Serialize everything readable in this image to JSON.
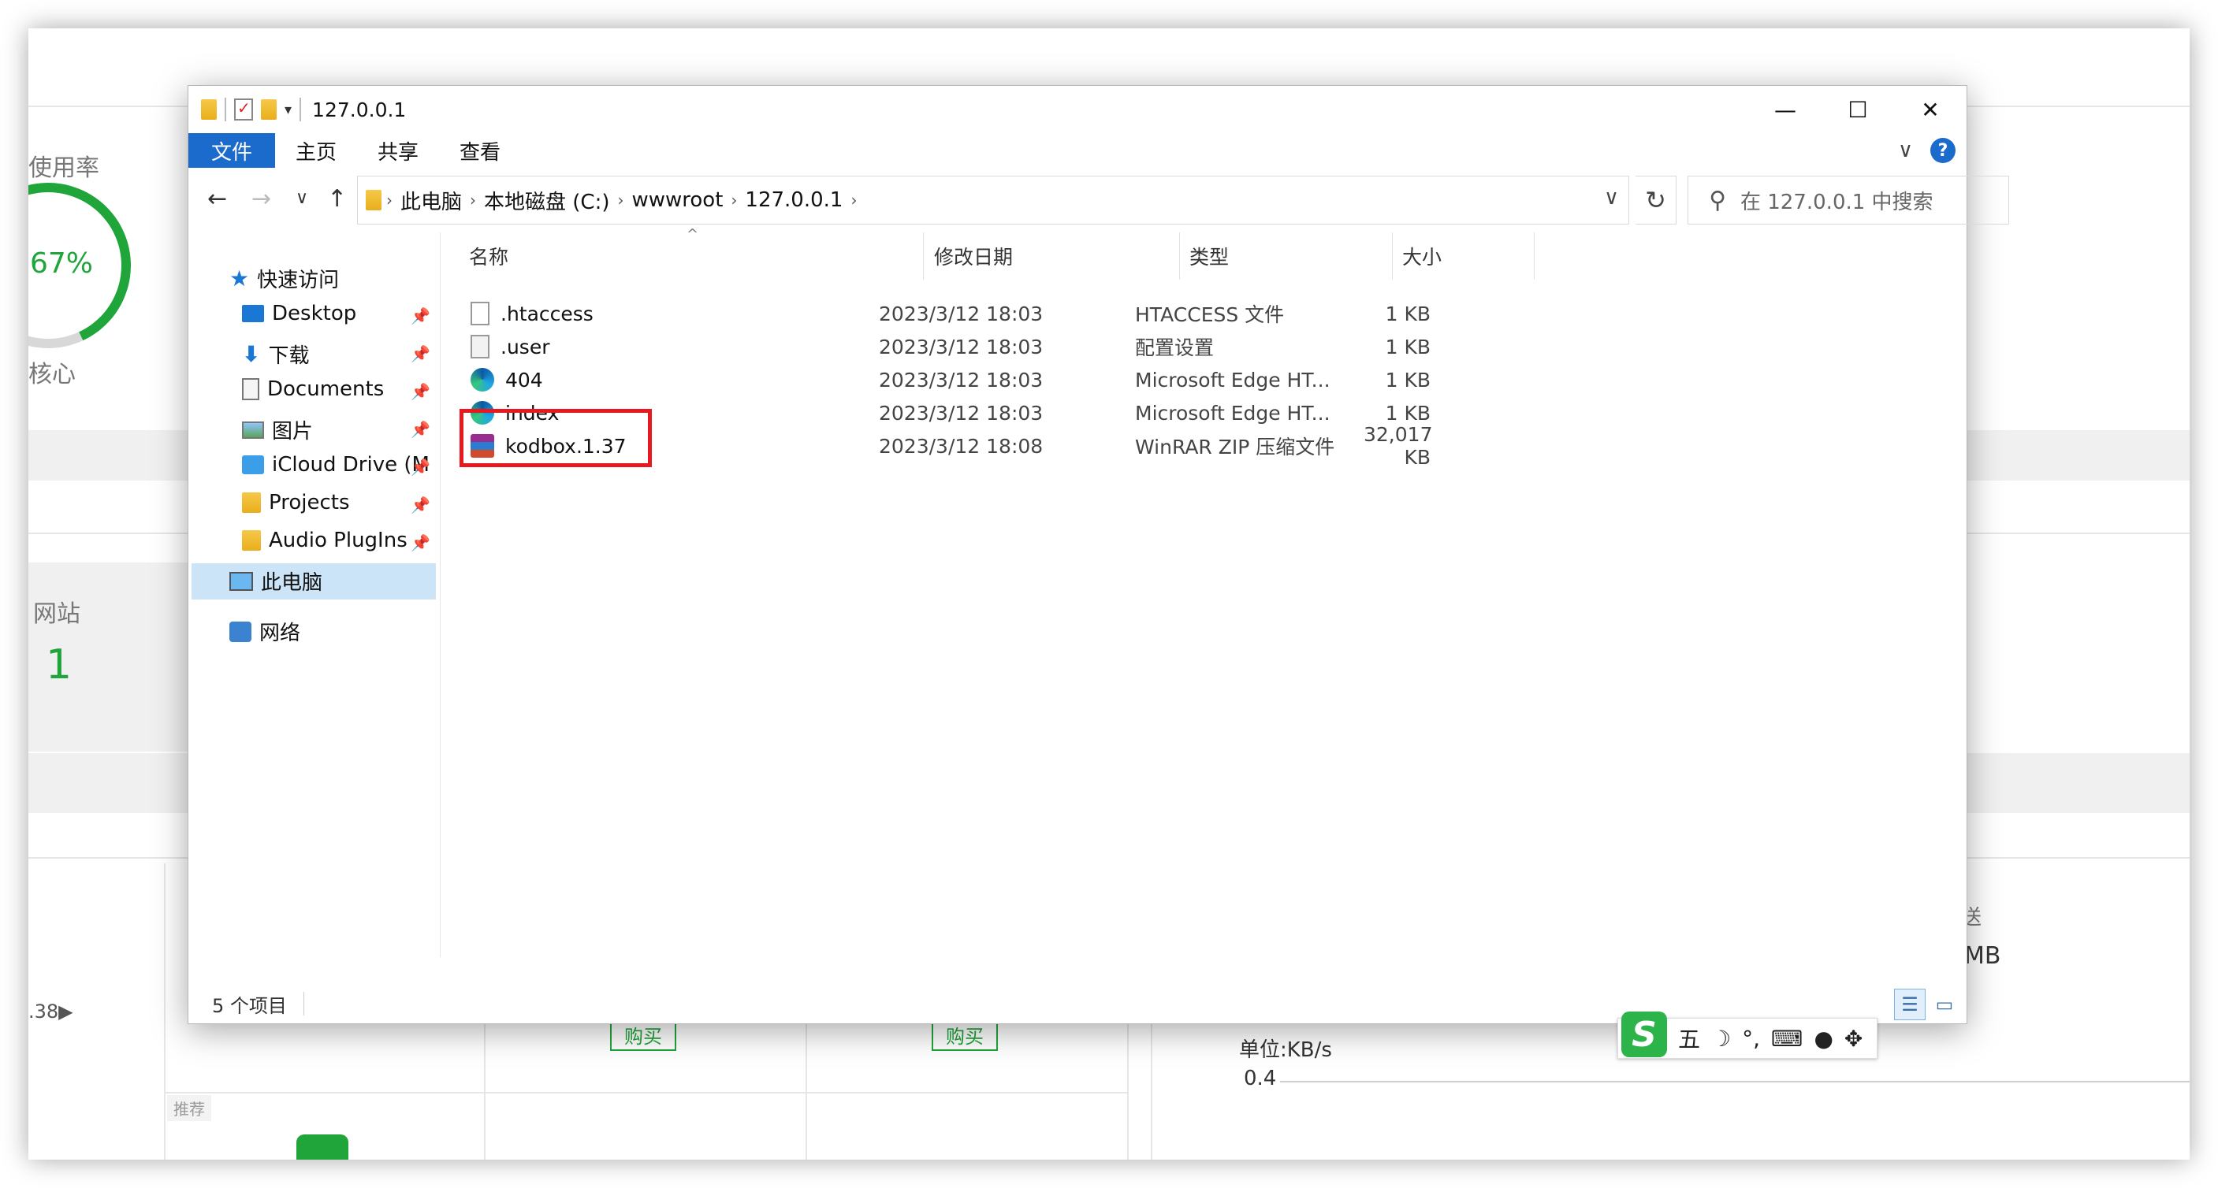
{
  "background": {
    "usage_label": "使用率",
    "usage_percent": "67%",
    "core_label": "核心",
    "site_label": "网站",
    "site_count": "1",
    "version_fragment": ".38▶",
    "buy_label_1": "购买",
    "buy_label_2": "购买",
    "recommend_label": "推荐",
    "send_fragment": "送",
    "mb_fragment": "MB",
    "unit_label": "单位:KB/s",
    "chart_value": "0.4"
  },
  "window": {
    "title": "127.0.0.1",
    "minimize": "—",
    "maximize": "☐",
    "close": "✕"
  },
  "ribbon": {
    "file_tab": "文件",
    "tabs": [
      "主页",
      "共享",
      "查看"
    ],
    "expand_icon": "∨",
    "help_label": "?"
  },
  "nav": {
    "back": "←",
    "forward": "→",
    "recent": "∨",
    "up": "↑",
    "breadcrumb": [
      "此电脑",
      "本地磁盘 (C:)",
      "wwwroot",
      "127.0.0.1"
    ],
    "refresh": "↻",
    "search_placeholder": "在 127.0.0.1 中搜索"
  },
  "sidebar": {
    "quick_access": "快速访问",
    "items": [
      {
        "label": "Desktop",
        "icon": "desktop-icon",
        "pinned": true
      },
      {
        "label": "下载",
        "icon": "download-icon",
        "pinned": true
      },
      {
        "label": "Documents",
        "icon": "documents-icon",
        "pinned": true
      },
      {
        "label": "图片",
        "icon": "pictures-icon",
        "pinned": true
      },
      {
        "label": "iCloud Drive (M",
        "icon": "icloud-icon",
        "pinned": true
      },
      {
        "label": "Projects",
        "icon": "folder-icon",
        "pinned": true
      },
      {
        "label": "Audio PlugIns",
        "icon": "folder-icon",
        "pinned": true
      }
    ],
    "this_pc": "此电脑",
    "network": "网络"
  },
  "columns": {
    "name": "名称",
    "date": "修改日期",
    "type": "类型",
    "size": "大小"
  },
  "files": [
    {
      "name": ".htaccess",
      "date": "2023/3/12 18:03",
      "type": "HTACCESS 文件",
      "size": "1 KB",
      "icon": "blank-file-icon"
    },
    {
      "name": ".user",
      "date": "2023/3/12 18:03",
      "type": "配置设置",
      "size": "1 KB",
      "icon": "config-file-icon"
    },
    {
      "name": "404",
      "date": "2023/3/12 18:03",
      "type": "Microsoft Edge HT...",
      "size": "1 KB",
      "icon": "edge-html-icon"
    },
    {
      "name": "index",
      "date": "2023/3/12 18:03",
      "type": "Microsoft Edge HT...",
      "size": "1 KB",
      "icon": "edge-html-icon"
    },
    {
      "name": "kodbox.1.37",
      "date": "2023/3/12 18:08",
      "type": "WinRAR ZIP 压缩文件",
      "size": "32,017 KB",
      "icon": "winrar-archive-icon"
    }
  ],
  "status": {
    "item_count": "5 个项目"
  },
  "ime": {
    "logo": "S",
    "mode": "五",
    "moon": "☽",
    "punct": "°,",
    "keyboard": "⌨",
    "user": "●",
    "apps": "✥"
  },
  "colors": {
    "accent_blue": "#1a6bcb",
    "panel_green": "#20a53a",
    "highlight_red": "#e8191e"
  }
}
